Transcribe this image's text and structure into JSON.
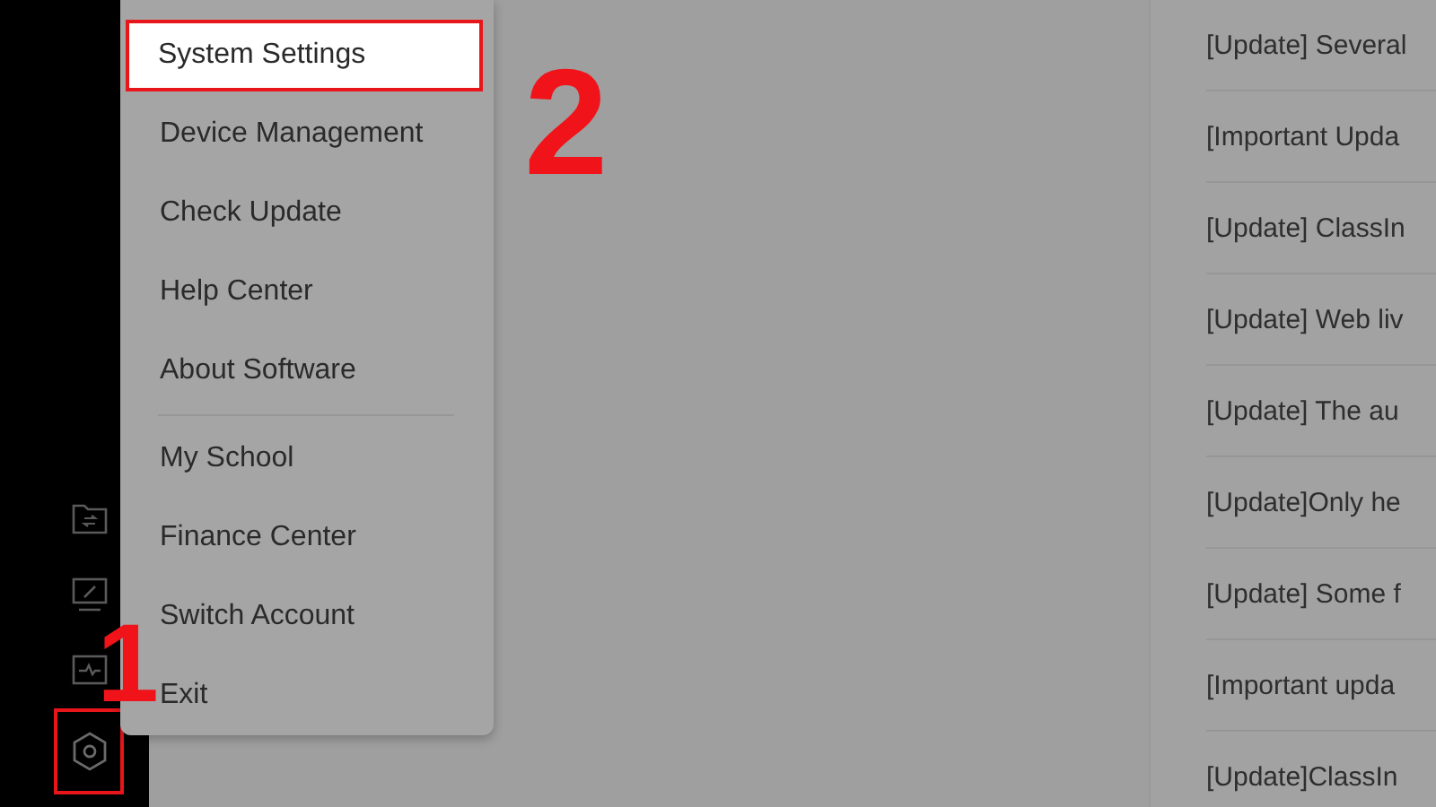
{
  "sidebar": {
    "icons": [
      {
        "kind": "folder",
        "selected": false
      },
      {
        "kind": "whiteboard",
        "selected": false
      },
      {
        "kind": "monitor",
        "selected": false
      },
      {
        "kind": "settings",
        "selected": true
      }
    ]
  },
  "menu": {
    "items": [
      {
        "label": "System Settings",
        "selected": true,
        "kind": "item"
      },
      {
        "label": "Device Management",
        "selected": false,
        "kind": "item"
      },
      {
        "label": "Check Update",
        "selected": false,
        "kind": "item"
      },
      {
        "label": "Help Center",
        "selected": false,
        "kind": "item"
      },
      {
        "label": "About Software",
        "selected": false,
        "kind": "item"
      },
      {
        "kind": "separator"
      },
      {
        "label": "My School",
        "selected": false,
        "kind": "item"
      },
      {
        "label": "Finance Center",
        "selected": false,
        "kind": "item"
      },
      {
        "label": "Switch Account",
        "selected": false,
        "kind": "item"
      },
      {
        "label": "Exit",
        "selected": false,
        "kind": "item"
      }
    ]
  },
  "updates": [
    "[Update] Several",
    "[Important Upda",
    "[Update] ClassIn",
    "[Update] Web liv",
    "[Update] The au",
    "[Update]Only he",
    "[Update] Some f",
    "[Important upda",
    "[Update]ClassIn"
  ],
  "annotations": [
    {
      "label": "1"
    },
    {
      "label": "2"
    }
  ]
}
